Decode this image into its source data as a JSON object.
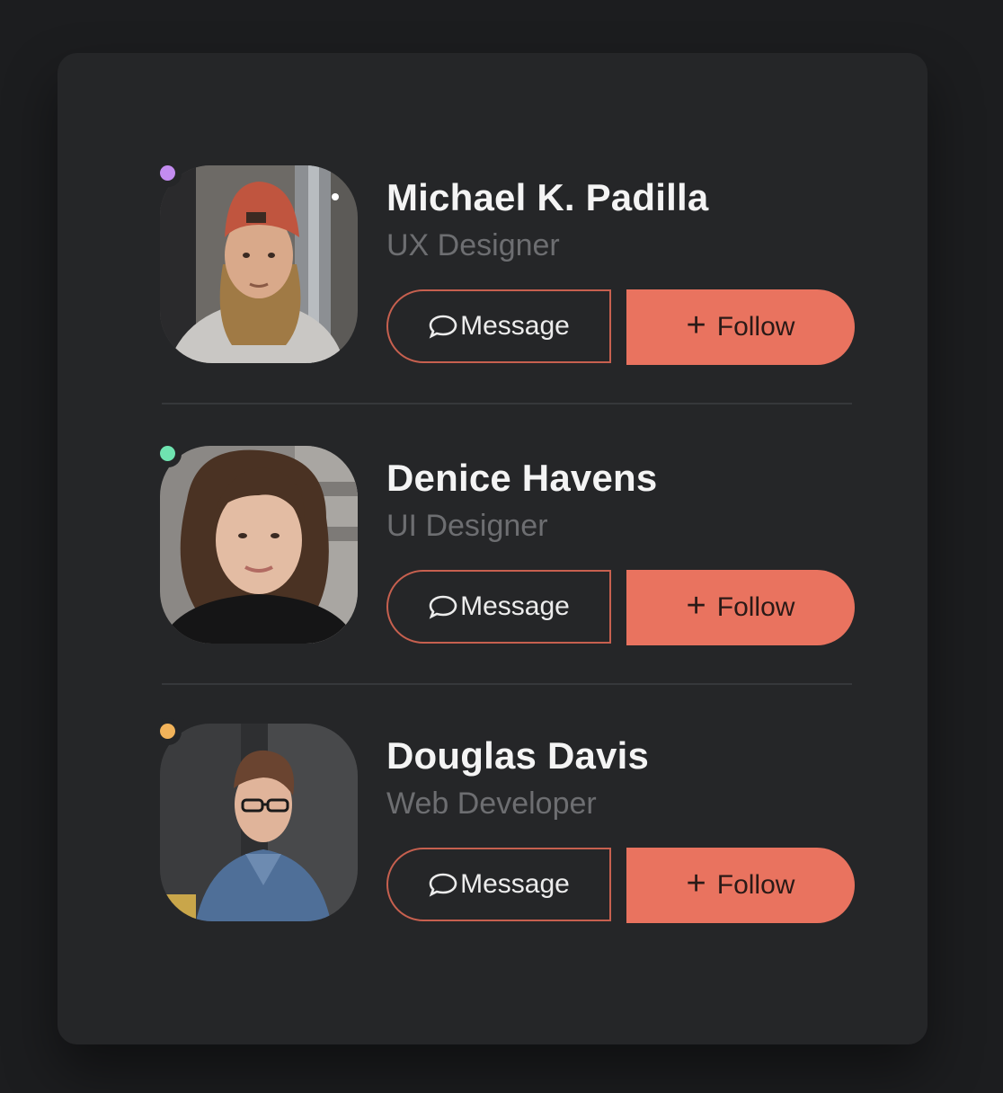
{
  "colors": {
    "accent": "#e9735f",
    "background": "#1c1d1f",
    "card": "#252628"
  },
  "profiles": [
    {
      "name": "Michael K. Padilla",
      "role": "UX Designer",
      "status_color": "#c38cf0",
      "message_label": "Message",
      "follow_label": "Follow",
      "message_icon": "chat-bubble-icon",
      "follow_icon": "plus-icon"
    },
    {
      "name": "Denice Havens",
      "role": "UI Designer",
      "status_color": "#6fe3b0",
      "message_label": "Message",
      "follow_label": "Follow",
      "message_icon": "chat-bubble-icon",
      "follow_icon": "plus-icon"
    },
    {
      "name": "Douglas Davis",
      "role": "Web Developer",
      "status_color": "#f2b35a",
      "message_label": "Message",
      "follow_label": "Follow",
      "message_icon": "chat-bubble-icon",
      "follow_icon": "plus-icon"
    }
  ]
}
